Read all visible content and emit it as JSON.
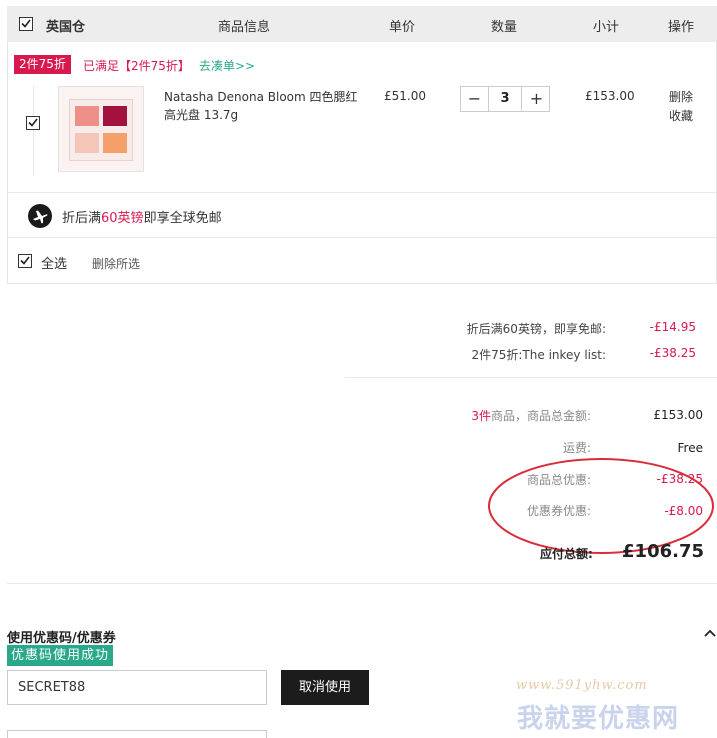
{
  "header": {
    "warehouse": "英国仓",
    "col_info": "商品信息",
    "col_price": "单价",
    "col_qty": "数量",
    "col_subtotal": "小计",
    "col_action": "操作"
  },
  "promo": {
    "tag": "2件75折",
    "met": "已满足【2件75折】",
    "link": "去凑单>>"
  },
  "item": {
    "name": "Natasha Denona Bloom 四色腮红高光盘 13.7g",
    "price": "£51.00",
    "quantity": "3",
    "minus": "−",
    "plus": "+",
    "subtotal": "£153.00",
    "delete": "删除",
    "favorite": "收藏",
    "palette_colors": [
      "#ef8f8a",
      "#a3113f",
      "#f4c6b8",
      "#f5a06a"
    ]
  },
  "shipping": {
    "prefix": "折后满",
    "highlight": "60英镑",
    "suffix": "即享全球免邮"
  },
  "footer_bar": {
    "select_all": "全选",
    "delete_selected": "删除所选"
  },
  "discounts": {
    "free_shipping_label": "折后满60英镑，即享免邮:",
    "free_shipping_value": "-£14.95",
    "promo_label": "2件75折:The inkey list:",
    "promo_value": "-£38.25"
  },
  "summary": {
    "count": "3件",
    "count_label": "商品，商品总金额:",
    "goods_total": "£153.00",
    "shipping_label": "运费:",
    "shipping_value": "Free",
    "goods_discount_label": "商品总优惠:",
    "goods_discount_value": "-£38.25",
    "coupon_discount_label": "优惠券优惠:",
    "coupon_discount_value": "-£8.00",
    "payable_label": "应付总额:",
    "payable_value": "£106.75"
  },
  "coupon": {
    "title": "使用优惠码/优惠券",
    "success": "优惠码使用成功",
    "code": "SECRET88",
    "cancel": "取消使用"
  },
  "watermark": {
    "url": "www.591yhw.com",
    "text": "我就要优惠网"
  },
  "colors": {
    "accent_red": "#d7194e",
    "accent_green": "#2aa88a",
    "annotation_circle": "#d92d3a"
  }
}
